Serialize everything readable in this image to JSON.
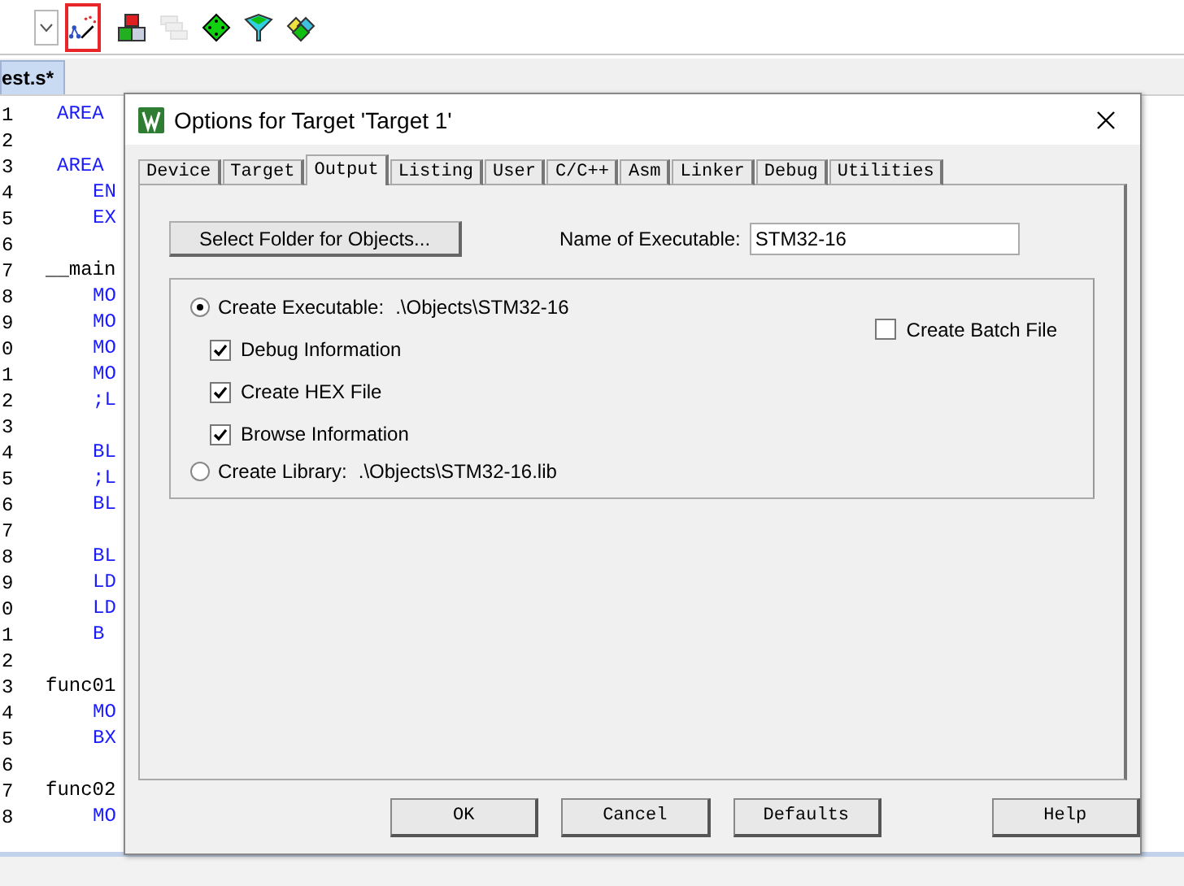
{
  "toolbar": {
    "items": [
      {
        "kind": "dropdown",
        "highlighted": false,
        "disabled": false
      },
      {
        "kind": "wand",
        "highlighted": true,
        "disabled": false
      },
      {
        "kind": "blocks",
        "highlighted": false,
        "disabled": false
      },
      {
        "kind": "windows",
        "highlighted": false,
        "disabled": true
      },
      {
        "kind": "diamond",
        "highlighted": false,
        "disabled": false
      },
      {
        "kind": "funnel",
        "highlighted": false,
        "disabled": false
      },
      {
        "kind": "diamonds",
        "highlighted": false,
        "disabled": false
      }
    ]
  },
  "editor": {
    "tab": "est.s*",
    "lines": [
      {
        "number": "1",
        "kind": "directive",
        "text": "AREA"
      },
      {
        "number": "2",
        "kind": "blank"
      },
      {
        "number": "3",
        "kind": "directive",
        "text": "AREA"
      },
      {
        "number": "4",
        "kind": "instruction",
        "text": "EN"
      },
      {
        "number": "5",
        "kind": "instruction",
        "text": "EX"
      },
      {
        "number": "6",
        "kind": "blank"
      },
      {
        "number": "7",
        "kind": "label",
        "text": "__main"
      },
      {
        "number": "8",
        "kind": "instruction",
        "text": "MO"
      },
      {
        "number": "9",
        "kind": "instruction",
        "text": "MO"
      },
      {
        "number": "0",
        "kind": "instruction",
        "text": "MO"
      },
      {
        "number": "1",
        "kind": "instruction",
        "text": "MO"
      },
      {
        "number": "2",
        "kind": "comment",
        "text": ";L"
      },
      {
        "number": "3",
        "kind": "blank"
      },
      {
        "number": "4",
        "kind": "instruction",
        "text": "BL"
      },
      {
        "number": "5",
        "kind": "comment",
        "text": ";L"
      },
      {
        "number": "6",
        "kind": "instruction",
        "text": "BL"
      },
      {
        "number": "7",
        "kind": "blank"
      },
      {
        "number": "8",
        "kind": "instruction",
        "text": "BL"
      },
      {
        "number": "9",
        "kind": "instruction",
        "text": "LD"
      },
      {
        "number": "0",
        "kind": "instruction",
        "text": "LD"
      },
      {
        "number": "1",
        "kind": "instruction",
        "text": "B"
      },
      {
        "number": "2",
        "kind": "blank"
      },
      {
        "number": "3",
        "kind": "label",
        "text": "func01"
      },
      {
        "number": "4",
        "kind": "instruction",
        "text": "MO"
      },
      {
        "number": "5",
        "kind": "instruction",
        "text": "BX"
      },
      {
        "number": "6",
        "kind": "blank"
      },
      {
        "number": "7",
        "kind": "label",
        "text": "func02"
      },
      {
        "number": "8",
        "kind": "instruction",
        "text": "MO"
      }
    ]
  },
  "dialog": {
    "title": "Options for Target 'Target 1'",
    "tabs": [
      {
        "label": "Device",
        "selected": false
      },
      {
        "label": "Target",
        "selected": false
      },
      {
        "label": "Output",
        "selected": true
      },
      {
        "label": "Listing",
        "selected": false
      },
      {
        "label": "User",
        "selected": false
      },
      {
        "label": "C/C++",
        "selected": false
      },
      {
        "label": "Asm",
        "selected": false
      },
      {
        "label": "Linker",
        "selected": false
      },
      {
        "label": "Debug",
        "selected": false
      },
      {
        "label": "Utilities",
        "selected": false
      }
    ],
    "select_folder_button": "Select Folder for Objects...",
    "executable_name": {
      "label": "Name of Executable:",
      "value": "STM32-16"
    },
    "create_executable": {
      "label": "Create Executable:",
      "path": ".\\Objects\\STM32-16",
      "selected": true
    },
    "options": [
      {
        "label": "Debug Information",
        "checked": true
      },
      {
        "label": "Create HEX File",
        "checked": true
      },
      {
        "label": "Browse Information",
        "checked": true
      }
    ],
    "create_batch_file": {
      "label": "Create Batch File",
      "checked": false
    },
    "create_library": {
      "label": "Create Library:",
      "path": ".\\Objects\\STM32-16.lib",
      "selected": false
    },
    "buttons": [
      {
        "label": "OK",
        "kind": "ok"
      },
      {
        "label": "Cancel",
        "kind": "normal"
      },
      {
        "label": "Defaults",
        "kind": "normal"
      },
      {
        "label": "Help",
        "kind": "help"
      }
    ]
  }
}
